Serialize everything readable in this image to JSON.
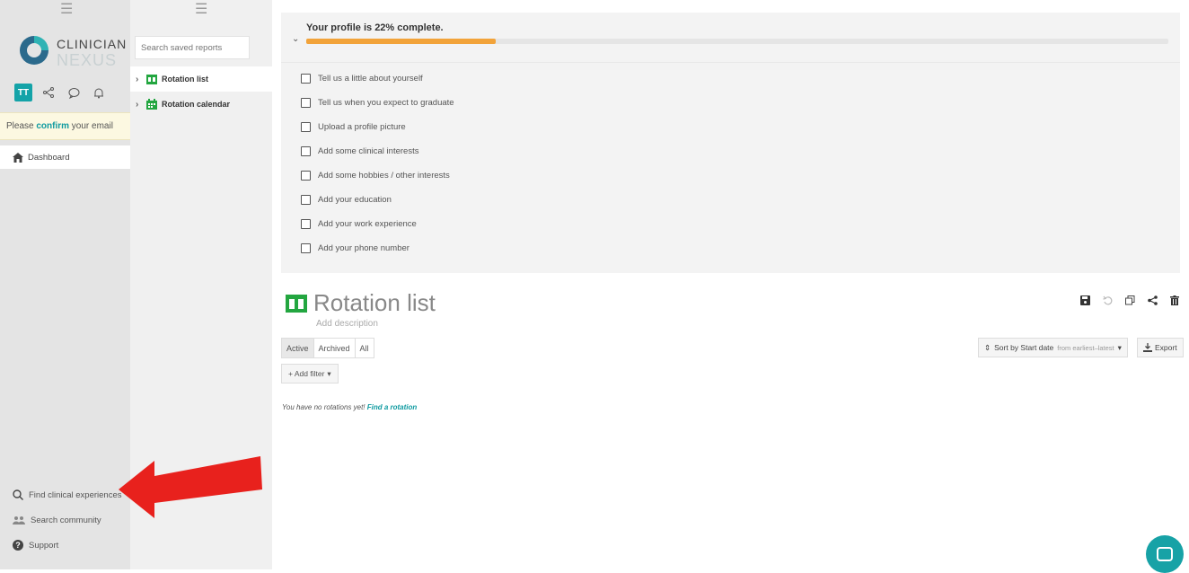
{
  "nav": {
    "brand_line1": "CLINICIAN",
    "brand_line2": "NEXUS",
    "avatar_initials": "TT",
    "confirm_prefix": "Please ",
    "confirm_link": "confirm",
    "confirm_suffix": " your email",
    "dashboard_label": "Dashboard",
    "bottom_items": [
      {
        "label": "Find clinical experiences",
        "icon": "search-icon"
      },
      {
        "label": "Search community",
        "icon": "people-icon"
      },
      {
        "label": "Support",
        "icon": "question-icon"
      }
    ]
  },
  "reports": {
    "search_placeholder": "Search saved reports",
    "items": [
      {
        "label": "Rotation list",
        "icon": "rotation-list-icon"
      },
      {
        "label": "Rotation calendar",
        "icon": "calendar-icon"
      }
    ]
  },
  "profile": {
    "title": "Your profile is 22% complete.",
    "percent": 22,
    "tasks": [
      "Tell us a little about yourself",
      "Tell us when you expect to graduate",
      "Upload a profile picture",
      "Add some clinical interests",
      "Add some hobbies / other interests",
      "Add your education",
      "Add your work experience",
      "Add your phone number"
    ]
  },
  "report": {
    "title": "Rotation list",
    "description_placeholder": "Add description",
    "tabs": [
      "Active",
      "Archived",
      "All"
    ],
    "sort_label": "Sort by Start date",
    "sort_order": "from earliest–latest",
    "export_label": "Export",
    "add_filter_label": "+ Add filter",
    "empty_text": "You have no rotations yet! ",
    "empty_link": "Find a rotation"
  },
  "colors": {
    "accent": "#0e9aa0",
    "progress": "#f2a33a",
    "report_icon": "#23a640",
    "annotation_arrow": "#e8211d"
  }
}
